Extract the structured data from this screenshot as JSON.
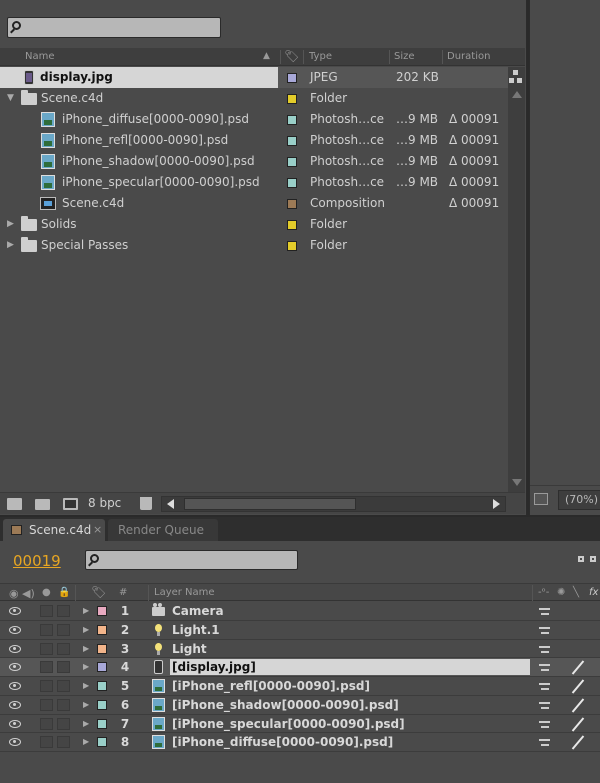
{
  "project": {
    "search": {
      "value": ""
    },
    "columns": {
      "name": "Name",
      "type": "Type",
      "size": "Size",
      "duration": "Duration"
    },
    "items": [
      {
        "name": "display.jpg",
        "icon": "jpg-icon",
        "label_color": "#a8a8d8",
        "type": "JPEG",
        "size": "202 KB",
        "duration": "",
        "selected": true
      },
      {
        "name": "Scene.c4d",
        "icon": "folder-icon",
        "label_color": "#e3cc2a",
        "type": "Folder",
        "size": "",
        "duration": ""
      },
      {
        "name": "iPhone_diffuse[0000-0090].psd",
        "icon": "psd-icon",
        "label_color": "#99cfc8",
        "type": "Photosh…ce",
        "size": "…9 MB",
        "duration": "Δ 00091"
      },
      {
        "name": "iPhone_refl[0000-0090].psd",
        "icon": "psd-icon",
        "label_color": "#99cfc8",
        "type": "Photosh…ce",
        "size": "…9 MB",
        "duration": "Δ 00091"
      },
      {
        "name": "iPhone_shadow[0000-0090].psd",
        "icon": "psd-icon",
        "label_color": "#99cfc8",
        "type": "Photosh…ce",
        "size": "…9 MB",
        "duration": "Δ 00091"
      },
      {
        "name": "iPhone_specular[0000-0090].psd",
        "icon": "psd-icon",
        "label_color": "#99cfc8",
        "type": "Photosh…ce",
        "size": "…9 MB",
        "duration": "Δ 00091"
      },
      {
        "name": "Scene.c4d",
        "icon": "comp-icon",
        "label_color": "#9c7a56",
        "type": "Composition",
        "size": "",
        "duration": "Δ 00091"
      },
      {
        "name": "Solids",
        "icon": "folder-icon",
        "label_color": "#e3cc2a",
        "type": "Folder",
        "size": "",
        "duration": ""
      },
      {
        "name": "Special Passes",
        "icon": "folder-icon",
        "label_color": "#e3cc2a",
        "type": "Folder",
        "size": "",
        "duration": ""
      }
    ],
    "footer": {
      "bpc": "8 bpc"
    }
  },
  "viewer": {
    "zoom": "(70%)"
  },
  "timeline": {
    "tabs": [
      {
        "label": "Scene.c4d",
        "active": true
      },
      {
        "label": "Render Queue",
        "active": false
      }
    ],
    "timecode": "00019",
    "search": {
      "value": ""
    },
    "columns": {
      "number": "#",
      "layer_name": "Layer Name",
      "fx": "fx"
    },
    "layers": [
      {
        "num": "1",
        "name": "Camera",
        "icon": "camera-icon",
        "label_color": "#e8a9c0"
      },
      {
        "num": "2",
        "name": "Light.1",
        "icon": "light-icon",
        "label_color": "#f2b48a"
      },
      {
        "num": "3",
        "name": "Light",
        "icon": "light-icon",
        "label_color": "#f2b48a"
      },
      {
        "num": "4",
        "name": "[display.jpg]",
        "icon": "jpg-icon",
        "label_color": "#a8a8d8",
        "selected": true
      },
      {
        "num": "5",
        "name": "[iPhone_refl[0000-0090].psd]",
        "icon": "psd-icon",
        "label_color": "#99cfc8"
      },
      {
        "num": "6",
        "name": "[iPhone_shadow[0000-0090].psd]",
        "icon": "psd-icon",
        "label_color": "#99cfc8"
      },
      {
        "num": "7",
        "name": "[iPhone_specular[0000-0090].psd]",
        "icon": "psd-icon",
        "label_color": "#99cfc8"
      },
      {
        "num": "8",
        "name": "[iPhone_diffuse[0000-0090].psd]",
        "icon": "psd-icon",
        "label_color": "#99cfc8"
      }
    ]
  }
}
